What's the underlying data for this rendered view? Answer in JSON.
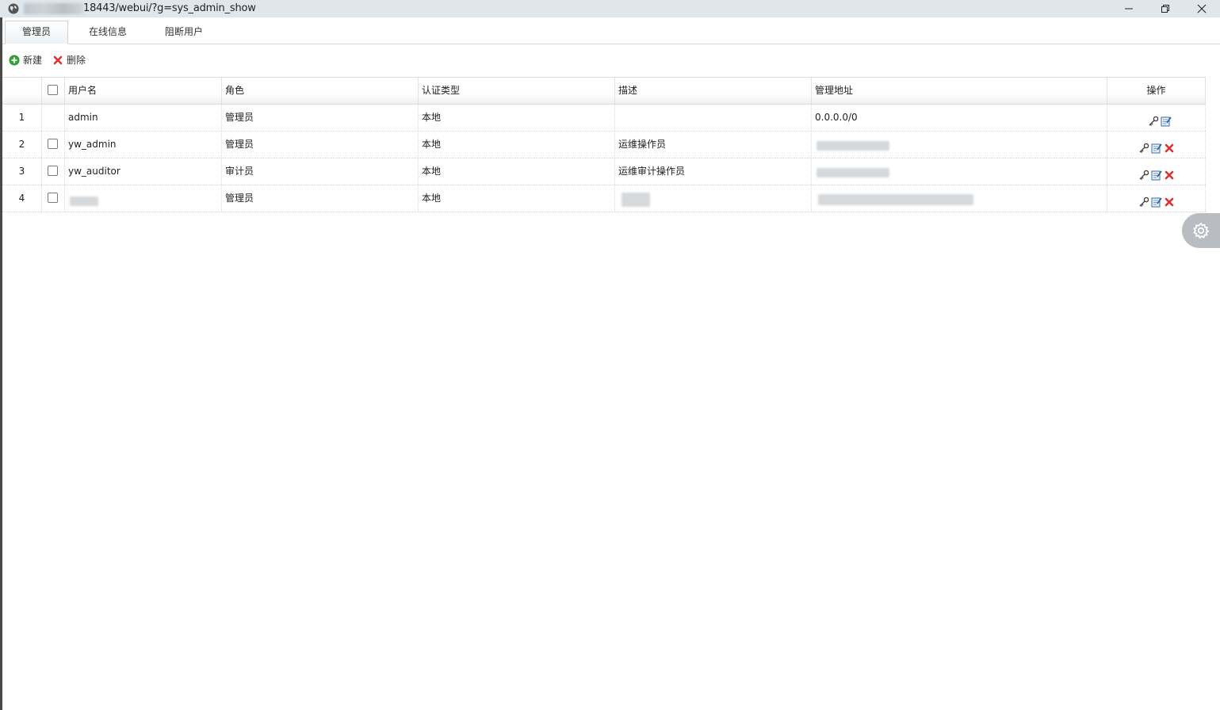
{
  "window": {
    "url_text": "18443/webui/?g=sys_admin_show",
    "buttons": {
      "minimize": "minimize",
      "maximize": "restore",
      "close": "close"
    }
  },
  "tabs": [
    {
      "label": "管理员",
      "active": true
    },
    {
      "label": "在线信息",
      "active": false
    },
    {
      "label": "阻断用户",
      "active": false
    }
  ],
  "toolbar": {
    "new_label": "新建",
    "delete_label": "删除"
  },
  "table": {
    "columns": {
      "username": "用户名",
      "role": "角色",
      "auth_type": "认证类型",
      "description": "描述",
      "address": "管理地址",
      "actions": "操作"
    },
    "rows": [
      {
        "num": "1",
        "username": "admin",
        "role": "管理员",
        "auth_type": "本地",
        "description": "",
        "address": "0.0.0.0/0",
        "checkbox": false,
        "deletable": false
      },
      {
        "num": "2",
        "username": "yw_admin",
        "role": "管理员",
        "auth_type": "本地",
        "description": "运维操作员",
        "address": "",
        "checkbox": true,
        "deletable": true
      },
      {
        "num": "3",
        "username": "yw_auditor",
        "role": "审计员",
        "auth_type": "本地",
        "description": "运维审计操作员",
        "address": "",
        "checkbox": true,
        "deletable": true
      },
      {
        "num": "4",
        "username": "",
        "role": "管理员",
        "auth_type": "本地",
        "description": "",
        "address": "",
        "checkbox": true,
        "deletable": true
      }
    ]
  },
  "colors": {
    "accent_green": "#3aa53a",
    "delete_red": "#e03030",
    "settings_bg": "#b9bdc2"
  },
  "icons": {
    "globe": "globe-icon",
    "new": "add-circle-icon",
    "delete": "delete-x-icon",
    "key": "key-icon",
    "edit": "edit-icon",
    "settings": "gear-icon"
  }
}
